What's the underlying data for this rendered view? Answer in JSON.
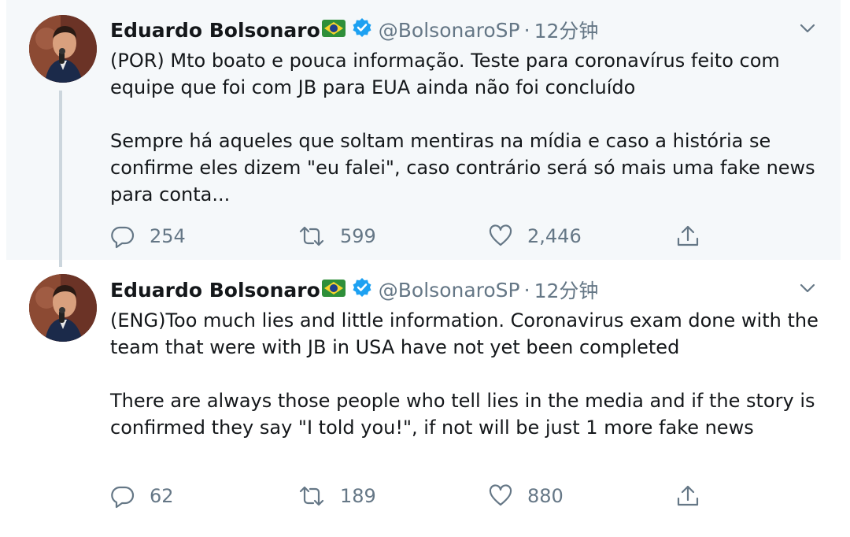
{
  "colors": {
    "background_highlight": "#f5f8fa",
    "text": "#14171a",
    "secondary": "#657786",
    "verified": "#1da1f2",
    "thread_line": "#ccd6dd"
  },
  "tweets": [
    {
      "author": {
        "name": "Eduardo Bolsonaro",
        "handle": "@BolsonaroSP",
        "verified": true,
        "flag_icon": "brazil-flag-icon"
      },
      "separator": "·",
      "time": "12分钟",
      "text_1": "(POR) Mto boato e pouca informação. Teste para coronavírus feito com equipe que foi com JB para EUA ainda não foi concluído",
      "text_2": "Sempre há aqueles que soltam mentiras na mídia e caso a história se confirme eles dizem \"eu falei\", caso contrário será só mais uma fake news para conta...",
      "replies": "254",
      "retweets": "599",
      "likes": "2,446"
    },
    {
      "author": {
        "name": "Eduardo Bolsonaro",
        "handle": "@BolsonaroSP",
        "verified": true,
        "flag_icon": "brazil-flag-icon"
      },
      "separator": "·",
      "time": "12分钟",
      "text_1": "(ENG)Too much lies and little information. Coronavirus exam done with the team that were with JB in USA have not yet been completed",
      "text_2": "There are always those people who tell lies in the media and if the story is confirmed they say \"I told you!\", if not will be just 1 more fake news",
      "replies": "62",
      "retweets": "189",
      "likes": "880"
    }
  ]
}
